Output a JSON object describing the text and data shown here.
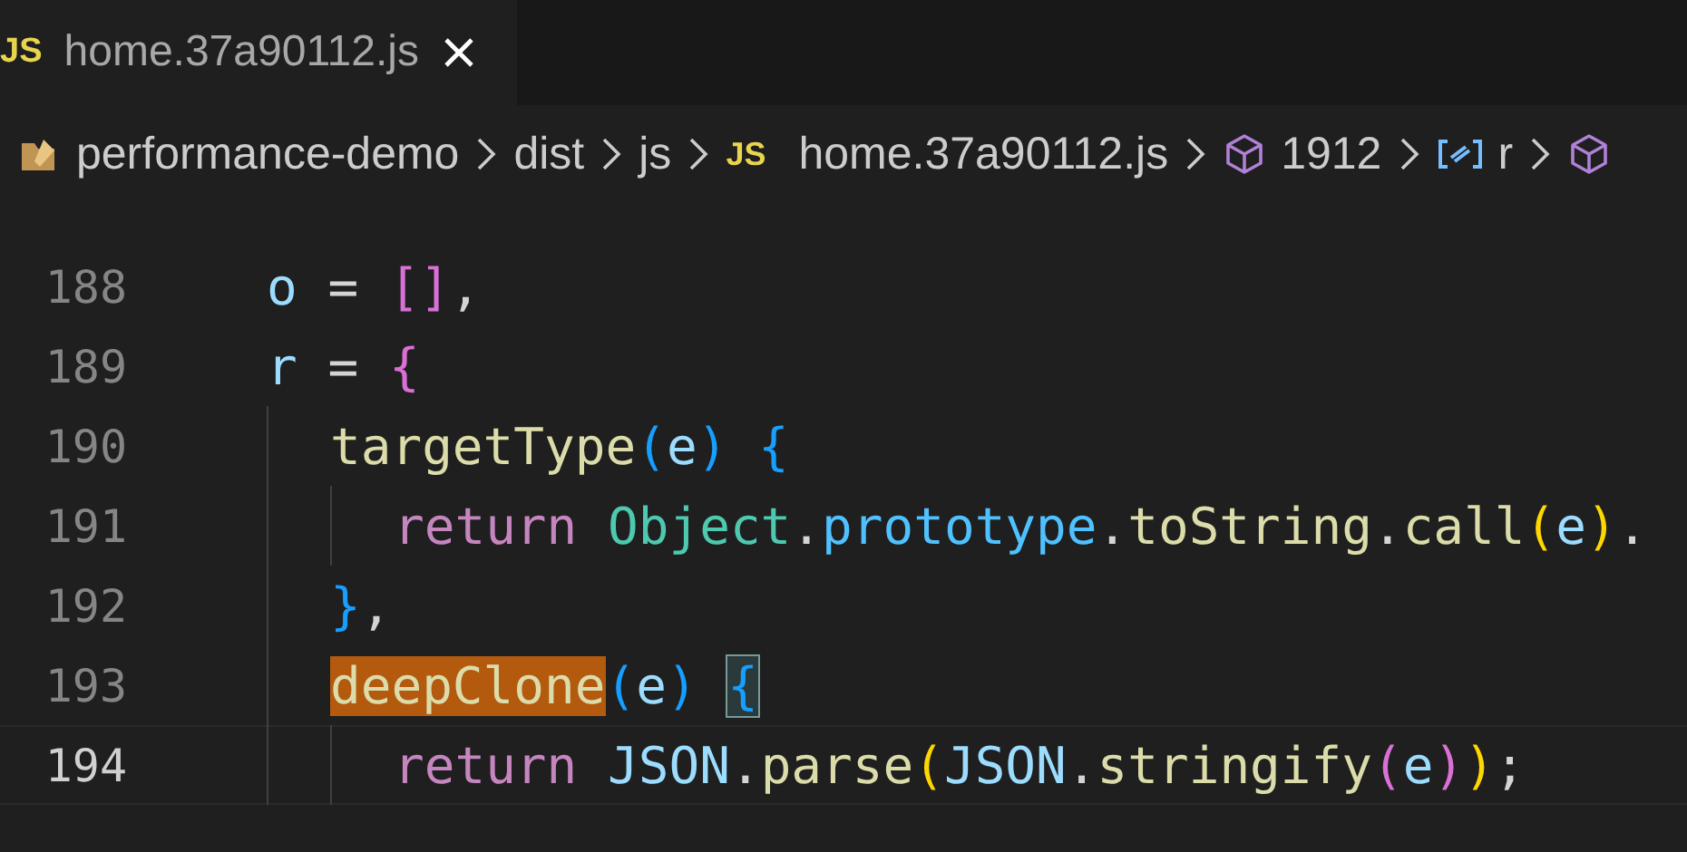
{
  "tab": {
    "badge": "JS",
    "label": "home.37a90112.js"
  },
  "breadcrumb": [
    {
      "kind": "folder",
      "label": "performance-demo"
    },
    {
      "kind": "text",
      "label": "dist"
    },
    {
      "kind": "text",
      "label": "js"
    },
    {
      "kind": "jsfile",
      "badge": "JS",
      "label": "home.37a90112.js"
    },
    {
      "kind": "module",
      "label": "1912"
    },
    {
      "kind": "variable",
      "label": "r"
    },
    {
      "kind": "module"
    }
  ],
  "lines": [
    {
      "number": "188",
      "current": false,
      "tokens": [
        {
          "kind": "var",
          "text": "o"
        },
        {
          "kind": "op",
          "text": " = "
        },
        {
          "kind": "b2",
          "text": "[]"
        },
        {
          "kind": "op",
          "text": ","
        }
      ]
    },
    {
      "number": "189",
      "current": false,
      "tokens": [
        {
          "kind": "var",
          "text": "r"
        },
        {
          "kind": "op",
          "text": " = "
        },
        {
          "kind": "b2",
          "text": "{"
        }
      ],
      "children": [
        {
          "number": "190",
          "current": false,
          "tokens": [
            {
              "kind": "func",
              "text": "targetType"
            },
            {
              "kind": "b3",
              "text": "("
            },
            {
              "kind": "var",
              "text": "e"
            },
            {
              "kind": "b3",
              "text": ") "
            },
            {
              "kind": "b3",
              "text": "{"
            }
          ],
          "children": [
            {
              "number": "191",
              "current": false,
              "tokens": [
                {
                  "kind": "keyword",
                  "text": "return "
                },
                {
                  "kind": "class",
                  "text": "Object"
                },
                {
                  "kind": "op",
                  "text": "."
                },
                {
                  "kind": "prop",
                  "text": "prototype"
                },
                {
                  "kind": "op",
                  "text": "."
                },
                {
                  "kind": "func",
                  "text": "toString"
                },
                {
                  "kind": "op",
                  "text": "."
                },
                {
                  "kind": "func",
                  "text": "call"
                },
                {
                  "kind": "b1",
                  "text": "("
                },
                {
                  "kind": "var",
                  "text": "e"
                },
                {
                  "kind": "b1",
                  "text": ")"
                },
                {
                  "kind": "op",
                  "text": "."
                }
              ]
            }
          ]
        },
        {
          "number": "192",
          "current": false,
          "tokens": [
            {
              "kind": "b3",
              "text": "}"
            },
            {
              "kind": "op",
              "text": ","
            }
          ]
        },
        {
          "number": "193",
          "current": false,
          "tokens": [
            {
              "kind": "func",
              "text": "deepClone",
              "highlighted": true
            },
            {
              "kind": "b3",
              "text": "("
            },
            {
              "kind": "var",
              "text": "e"
            },
            {
              "kind": "b3",
              "text": ") "
            },
            {
              "kind": "b3",
              "text": "{",
              "matched": true
            }
          ],
          "children": [
            {
              "number": "194",
              "current": true,
              "tokens": [
                {
                  "kind": "keyword",
                  "text": "return "
                },
                {
                  "kind": "var",
                  "text": "JSON"
                },
                {
                  "kind": "op",
                  "text": "."
                },
                {
                  "kind": "func",
                  "text": "parse"
                },
                {
                  "kind": "b1",
                  "text": "("
                },
                {
                  "kind": "var",
                  "text": "JSON"
                },
                {
                  "kind": "op",
                  "text": "."
                },
                {
                  "kind": "func",
                  "text": "stringify"
                },
                {
                  "kind": "b2",
                  "text": "("
                },
                {
                  "kind": "var",
                  "text": "e"
                },
                {
                  "kind": "b2",
                  "text": ")"
                },
                {
                  "kind": "b1",
                  "text": ")"
                },
                {
                  "kind": "op",
                  "text": ";"
                }
              ]
            }
          ]
        }
      ]
    }
  ]
}
